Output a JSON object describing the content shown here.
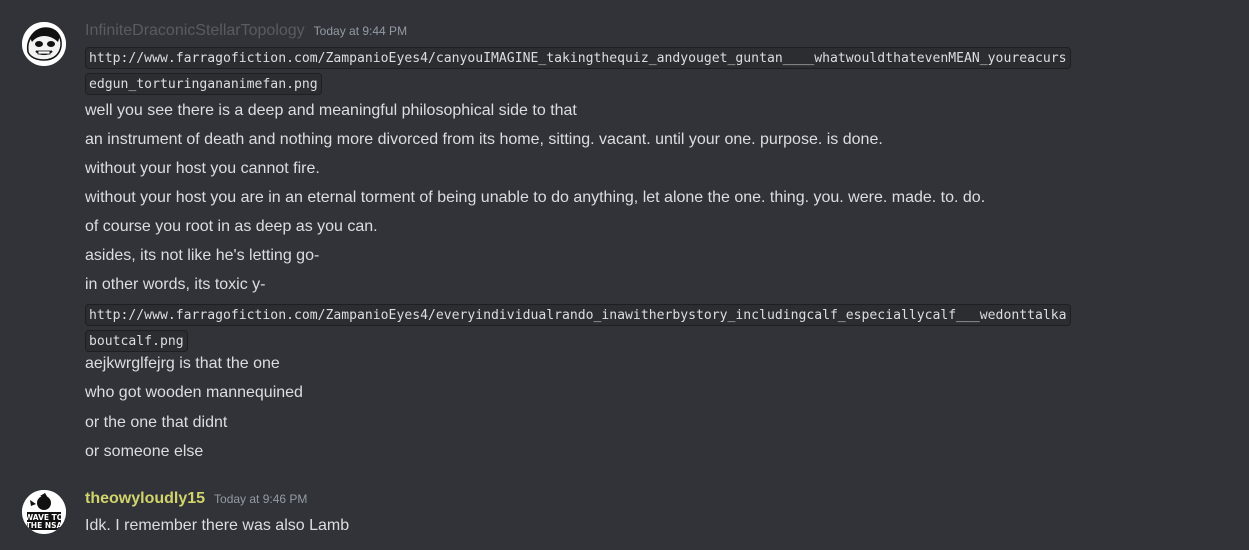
{
  "messages": [
    {
      "author": "InfiniteDraconicStellarTopology",
      "author_color": "#5c5a60",
      "timestamp": "Today at 9:44 PM",
      "lines": [
        {
          "type": "code",
          "parts": [
            "http://www.farragofiction.com/ZampanioEyes4/canyouIMAGINE_takingthequiz_andyouget_guntan____whatwouldthatevenMEAN_youreacurs",
            "edgun_torturingananimefan.png"
          ]
        },
        {
          "type": "text",
          "text": "well you see there is a deep and meaningful philosophical side to that"
        },
        {
          "type": "text",
          "text": "an instrument of death and nothing more divorced from its home, sitting. vacant. until your one. purpose. is done."
        },
        {
          "type": "text",
          "text": "without your host you cannot fire."
        },
        {
          "type": "text",
          "text": "without your host you are in an eternal torment of being unable to do anything, let alone the one. thing. you. were. made. to. do."
        },
        {
          "type": "text",
          "text": "of course you root in as deep as you can."
        },
        {
          "type": "text",
          "text": "asides, its not like he's letting go-"
        },
        {
          "type": "text",
          "text": "in other words, its toxic y-"
        },
        {
          "type": "code",
          "parts": [
            "http://www.farragofiction.com/ZampanioEyes4/everyindividualrando_inawitherbystory_includingcalf_especiallycalf___wedonttalka",
            "boutcalf.png"
          ]
        },
        {
          "type": "text",
          "text": "aejkwrglfejrg is that the one"
        },
        {
          "type": "text",
          "text": "who got wooden mannequined"
        },
        {
          "type": "text",
          "text": "or the one that didnt"
        },
        {
          "type": "text",
          "text": "or someone else"
        }
      ]
    },
    {
      "author": "theowyloudly15",
      "author_color": "#d1d46b",
      "timestamp": "Today at 9:46 PM",
      "avatar_text": [
        "WAVE TO",
        "THE NSA"
      ],
      "lines": [
        {
          "type": "text",
          "text": "Idk. I remember there was also Lamb"
        }
      ]
    }
  ]
}
